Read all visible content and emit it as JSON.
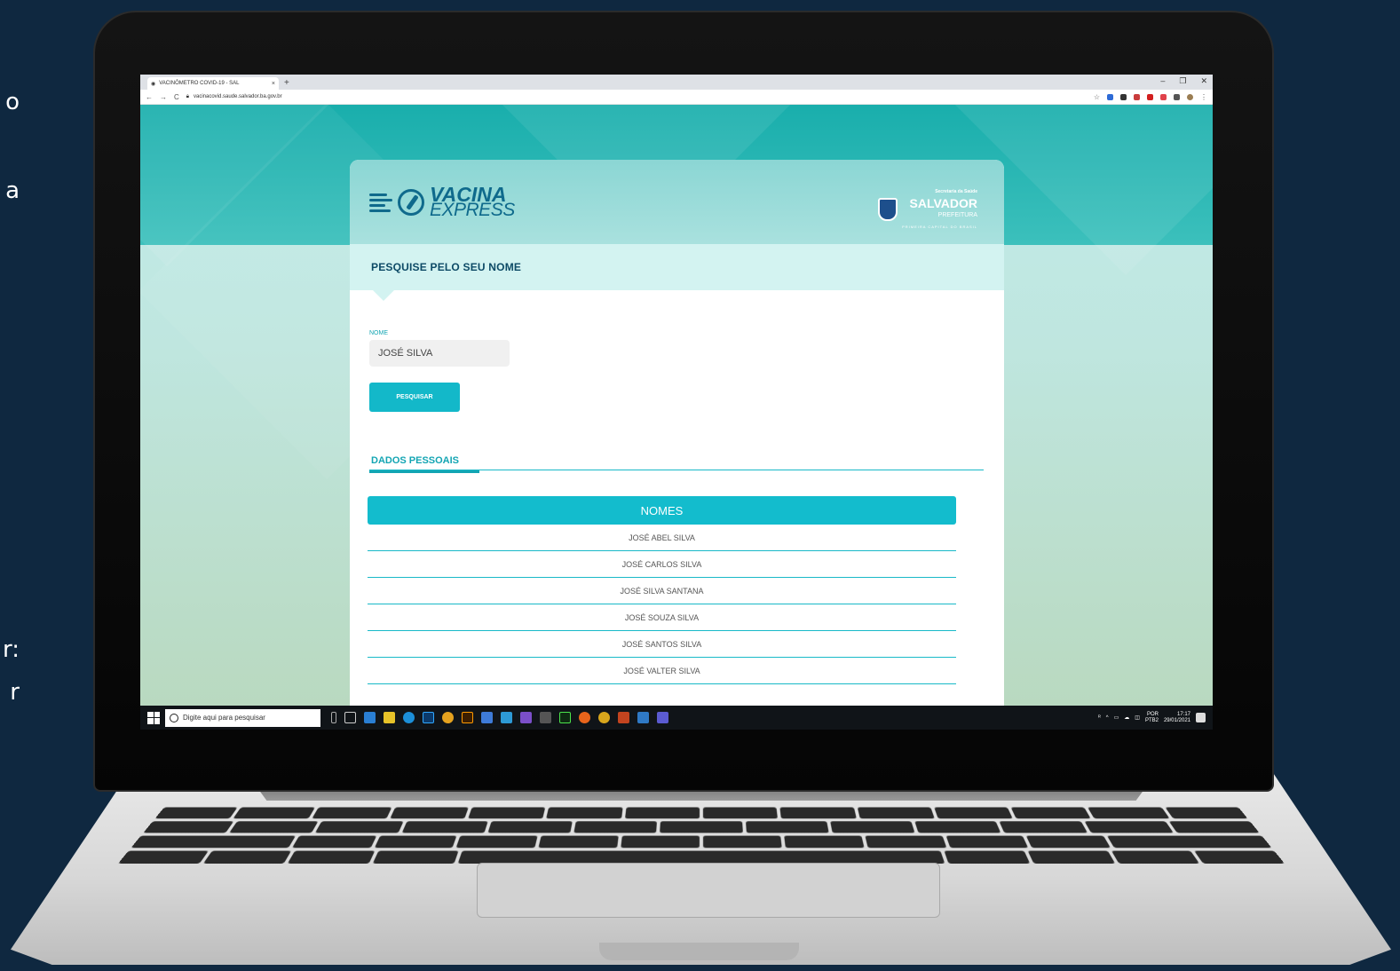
{
  "left_fragments": [
    "o",
    "a",
    "r:",
    "r"
  ],
  "browser": {
    "tab_title": "VACINÔMETRO COVID-19 - SAL",
    "tab_close": "×",
    "new_tab": "+",
    "window_controls": [
      "–",
      "❐",
      "✕"
    ],
    "nav_back": "←",
    "nav_forward": "→",
    "nav_reload": "C",
    "url": "vacinacovid.saude.salvador.ba.gov.br"
  },
  "logo": {
    "main": "VACINA",
    "sub": "EXPRESS"
  },
  "gov": {
    "small": "Secretaria da Saúde",
    "big": "SALVADOR",
    "mid": "PREFEITURA",
    "tag": "PRIMEIRA CAPITAL DO BRASIL"
  },
  "section_title": "PESQUISE PELO SEU NOME",
  "form": {
    "label": "NOME",
    "value": "JOSÉ SILVA",
    "button": "PESQUISAR"
  },
  "tabs": {
    "active": "DADOS PESSOAIS"
  },
  "table": {
    "header": "NOMES",
    "rows": [
      "JOSÉ ABEL SILVA",
      "JOSÉ CARLOS SILVA",
      "JOSÉ SILVA SANTANA",
      "JOSÉ SOUZA SILVA",
      "JOSÉ SANTOS SILVA",
      "JOSÉ VALTER SILVA"
    ]
  },
  "taskbar": {
    "search_placeholder": "Digite aqui para pesquisar",
    "lang": "POR",
    "lang2": "PTB2",
    "time": "17:17",
    "date": "29/01/2021"
  },
  "colors": {
    "accent": "#13b8c9",
    "brand_dark": "#0f6a8c",
    "teal_band": "#19aeac"
  }
}
